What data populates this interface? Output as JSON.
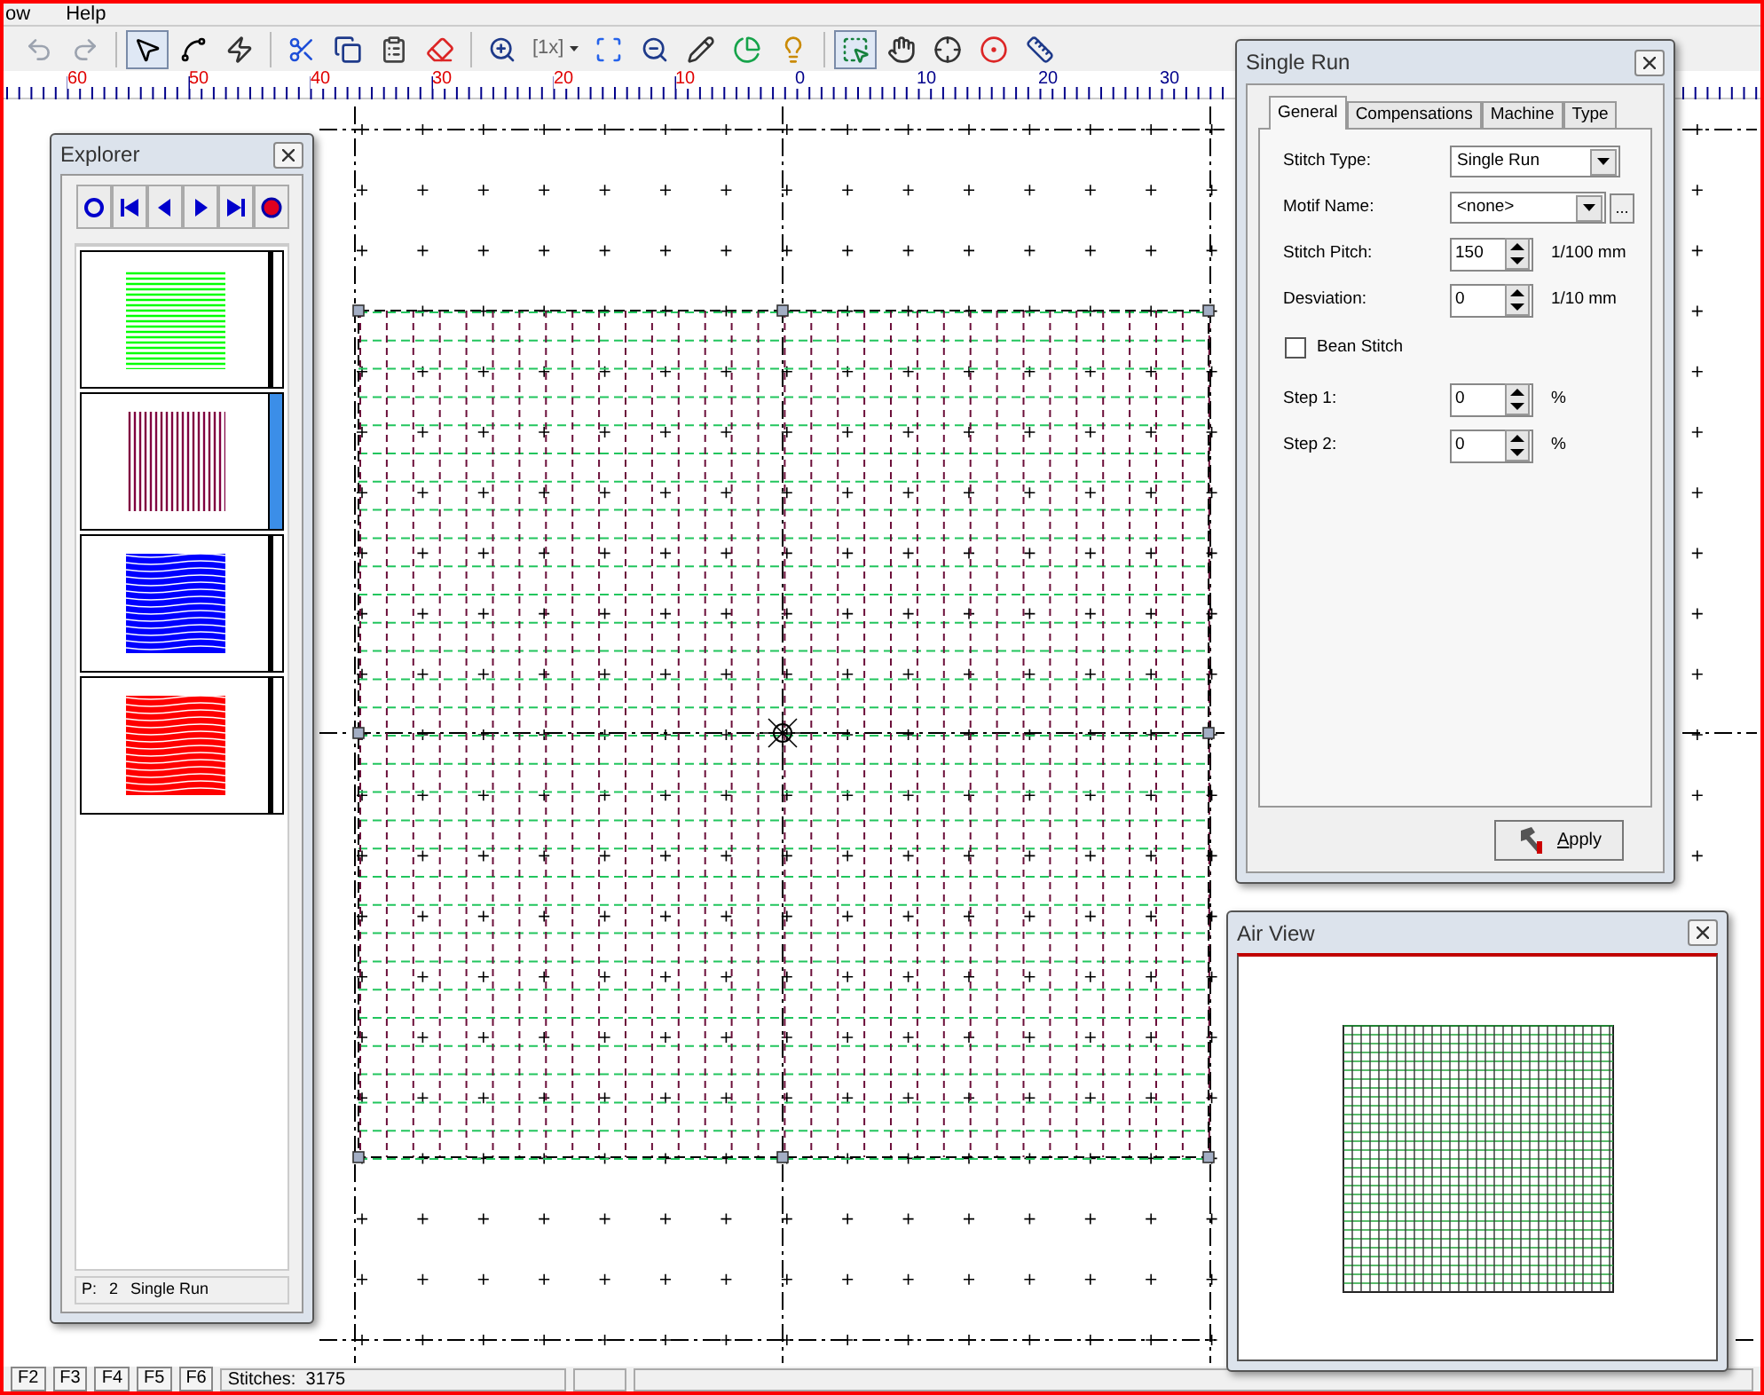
{
  "menu": [
    "ow",
    "Help"
  ],
  "toolbar": [
    {
      "selected": false
    },
    {
      "selected": false
    },
    {
      "selected": true
    },
    {
      "selected": false
    },
    {
      "selected": false
    },
    {
      "selected": false
    },
    {
      "selected": false
    },
    {
      "selected": false
    },
    {
      "selected": false
    },
    {
      "selected": false
    },
    {
      "label": "[1x]",
      "selected": false
    },
    {
      "selected": false
    },
    {
      "selected": false
    },
    {
      "selected": false
    },
    {
      "selected": false
    },
    {
      "selected": false
    },
    {
      "selected": true
    },
    {
      "selected": false
    },
    {
      "selected": false
    },
    {
      "selected": false
    },
    {
      "selected": false
    }
  ],
  "ruler": {
    "negative": [
      "60",
      "50",
      "40",
      "30",
      "20",
      "10"
    ],
    "positive": [
      "0",
      "10",
      "20",
      "30"
    ]
  },
  "explorer": {
    "title": "Explorer",
    "items": [
      {
        "kind": "horizontal",
        "color": "#00ff00",
        "selected": false
      },
      {
        "kind": "vertical",
        "color": "#800040",
        "selected": true
      },
      {
        "kind": "fill",
        "color": "#0000ff",
        "selected": false
      },
      {
        "kind": "fill",
        "color": "#ff0000",
        "selected": false
      }
    ],
    "status": [
      "P:",
      "2",
      "Single Run"
    ]
  },
  "single_run": {
    "title": "Single Run",
    "tabs": [
      {
        "label": "General",
        "selected": true
      },
      {
        "label": "Compensations",
        "selected": false
      },
      {
        "label": "Machine",
        "selected": false
      },
      {
        "label": "Type",
        "selected": false
      }
    ],
    "fields": [
      {
        "kind": "select",
        "label": "Stitch Type:",
        "value": "Single Run"
      },
      {
        "kind": "select_browse",
        "label": "Motif Name:",
        "value": "<none>",
        "button": "..."
      },
      {
        "kind": "spin",
        "label": "Stitch Pitch:",
        "value": "150",
        "unit": "1/100 mm"
      },
      {
        "kind": "spin",
        "label": "Desviation:",
        "value": "0",
        "unit": "1/10 mm"
      },
      {
        "kind": "checkbox",
        "label": "Bean Stitch",
        "checked": false
      },
      {
        "kind": "spin",
        "label": "Step 1:",
        "value": "0",
        "unit": "%"
      },
      {
        "kind": "spin",
        "label": "Step 2:",
        "value": "0",
        "unit": "%"
      }
    ],
    "apply": "Apply"
  },
  "air_view": {
    "title": "Air View"
  },
  "status_bar": {
    "keys": [
      "F2",
      "F3",
      "F4",
      "F5",
      "F6"
    ],
    "stitches": "Stitches:  3175"
  }
}
